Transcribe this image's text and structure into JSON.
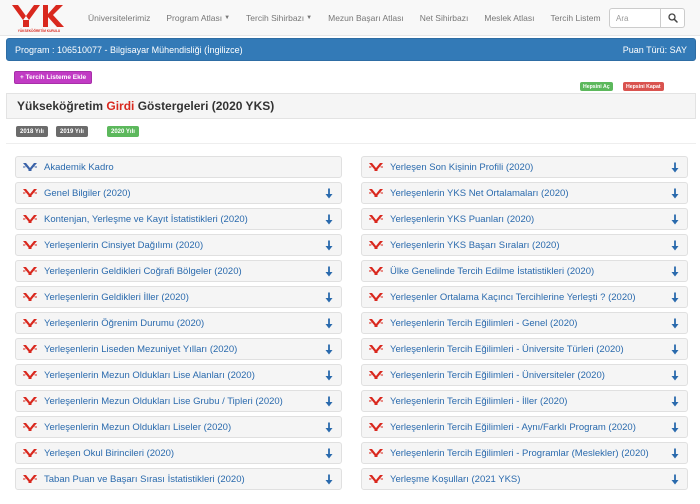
{
  "nav": {
    "items": [
      {
        "label": "Üniversitelerimiz",
        "caret": false
      },
      {
        "label": "Program Atlası",
        "caret": true
      },
      {
        "label": "Tercih Sihirbazı",
        "caret": true
      },
      {
        "label": "Mezun Başarı Atlası",
        "caret": false
      },
      {
        "label": "Net Sihirbazı",
        "caret": false
      },
      {
        "label": "Meslek Atlası",
        "caret": false
      },
      {
        "label": "Tercih Listem",
        "caret": false
      }
    ],
    "search_placeholder": "Ara",
    "logo_text": "YÜKSEKÖĞRETİM KURULU"
  },
  "program": {
    "label": "Program : 106510077 - Bilgisayar Mühendisliği (İngilizce)",
    "score_type": "Puan Türü: SAY"
  },
  "actions": {
    "add_to_list": "+ Tercih Listeme Ekle",
    "expand_all": "Hepsini Aç",
    "collapse_all": "Hepsini Kapat"
  },
  "heading": {
    "prefix": "Yükseköğretim ",
    "highlight": "Girdi",
    "suffix": " Göstergeleri (2020 YKS)"
  },
  "years": [
    "2018 Yılı",
    "2019 Yılı",
    "2020 Yılı"
  ],
  "colors": {
    "primary": "#337ab7",
    "link": "#2a6aad",
    "logo_red": "#d9281e",
    "add_button": "#c13bc4",
    "success": "#5cb85c",
    "danger": "#d9534f"
  },
  "left_items": [
    {
      "label": "Akademik Kadro",
      "icon": "yok-logo-blue-icon",
      "arrow": false
    },
    {
      "label": "Genel Bilgiler (2020)",
      "icon": "yok-logo-icon",
      "arrow": true
    },
    {
      "label": "Kontenjan, Yerleşme ve Kayıt İstatistikleri (2020)",
      "icon": "yok-logo-icon",
      "arrow": true
    },
    {
      "label": "Yerleşenlerin Cinsiyet Dağılımı (2020)",
      "icon": "yok-logo-icon",
      "arrow": true
    },
    {
      "label": "Yerleşenlerin Geldikleri Coğrafi Bölgeler (2020)",
      "icon": "yok-logo-icon",
      "arrow": true
    },
    {
      "label": "Yerleşenlerin Geldikleri İller (2020)",
      "icon": "yok-logo-icon",
      "arrow": true
    },
    {
      "label": "Yerleşenlerin Öğrenim Durumu (2020)",
      "icon": "yok-logo-icon",
      "arrow": true
    },
    {
      "label": "Yerleşenlerin Liseden Mezuniyet Yılları (2020)",
      "icon": "yok-logo-icon",
      "arrow": true
    },
    {
      "label": "Yerleşenlerin Mezun Oldukları Lise Alanları (2020)",
      "icon": "yok-logo-icon",
      "arrow": true
    },
    {
      "label": "Yerleşenlerin Mezun Oldukları Lise Grubu / Tipleri (2020)",
      "icon": "yok-logo-icon",
      "arrow": true
    },
    {
      "label": "Yerleşenlerin Mezun Oldukları Liseler (2020)",
      "icon": "yok-logo-icon",
      "arrow": true
    },
    {
      "label": "Yerleşen Okul Birincileri (2020)",
      "icon": "yok-logo-icon",
      "arrow": true
    },
    {
      "label": "Taban Puan ve Başarı Sırası İstatistikleri (2020)",
      "icon": "yok-logo-icon",
      "arrow": true
    }
  ],
  "right_items": [
    {
      "label": "Yerleşen Son Kişinin Profili (2020)",
      "icon": "yok-logo-icon",
      "arrow": true
    },
    {
      "label": "Yerleşenlerin YKS Net Ortalamaları (2020)",
      "icon": "yok-logo-icon",
      "arrow": true
    },
    {
      "label": "Yerleşenlerin YKS Puanları (2020)",
      "icon": "yok-logo-icon",
      "arrow": true
    },
    {
      "label": "Yerleşenlerin YKS Başarı Sıraları (2020)",
      "icon": "yok-logo-icon",
      "arrow": true
    },
    {
      "label": "Ülke Genelinde Tercih Edilme İstatistikleri (2020)",
      "icon": "yok-logo-icon",
      "arrow": true
    },
    {
      "label": "Yerleşenler Ortalama Kaçıncı Tercihlerine Yerleşti ? (2020)",
      "icon": "yok-logo-icon",
      "arrow": true
    },
    {
      "label": "Yerleşenlerin Tercih Eğilimleri - Genel (2020)",
      "icon": "yok-logo-icon",
      "arrow": true
    },
    {
      "label": "Yerleşenlerin Tercih Eğilimleri - Üniversite Türleri (2020)",
      "icon": "yok-logo-icon",
      "arrow": true
    },
    {
      "label": "Yerleşenlerin Tercih Eğilimleri - Üniversiteler (2020)",
      "icon": "yok-logo-icon",
      "arrow": true
    },
    {
      "label": "Yerleşenlerin Tercih Eğilimleri - İller (2020)",
      "icon": "yok-logo-icon",
      "arrow": true
    },
    {
      "label": "Yerleşenlerin Tercih Eğilimleri - Aynı/Farklı Program (2020)",
      "icon": "yok-logo-icon",
      "arrow": true
    },
    {
      "label": "Yerleşenlerin Tercih Eğilimleri - Programlar (Meslekler) (2020)",
      "icon": "yok-logo-icon",
      "arrow": true
    },
    {
      "label": "Yerleşme Koşulları (2021 YKS)",
      "icon": "yok-logo-icon",
      "arrow": true
    }
  ]
}
